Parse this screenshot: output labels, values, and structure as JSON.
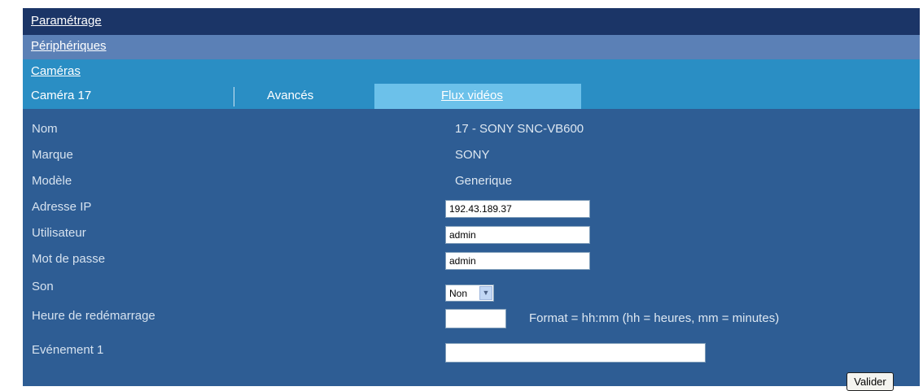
{
  "nav": {
    "parametrage": "Paramétrage",
    "peripheriques": "Périphériques",
    "cameras": "Caméras"
  },
  "tabs": [
    {
      "label": "Caméra 17"
    },
    {
      "label": "Avancés"
    },
    {
      "label": "Flux vidéos",
      "active": true
    }
  ],
  "form": {
    "nom": {
      "label": "Nom",
      "value": "17 - SONY SNC-VB600"
    },
    "marque": {
      "label": "Marque",
      "value": "SONY"
    },
    "modele": {
      "label": "Modèle",
      "value": "Generique"
    },
    "adresse_ip": {
      "label": "Adresse IP",
      "value": "192.43.189.37"
    },
    "utilisateur": {
      "label": "Utilisateur",
      "value": "admin"
    },
    "mot_de_passe": {
      "label": "Mot de passe",
      "value": "admin"
    },
    "son": {
      "label": "Son",
      "value": "Non"
    },
    "heure": {
      "label": "Heure de redémarrage",
      "value": "",
      "hint": "Format = hh:mm  (hh = heures, mm = minutes)"
    },
    "evenement": {
      "label": "Evénement 1",
      "value": ""
    }
  },
  "buttons": {
    "valider": "Valider"
  },
  "colors": {
    "header": "#1b3567",
    "subheader": "#5b80b6",
    "tabbar": "#2a8ec4",
    "active_tab": "#6cc1ea",
    "panel": "#2e5d94"
  },
  "icons": {
    "son_select": "chevron-down-icon"
  }
}
